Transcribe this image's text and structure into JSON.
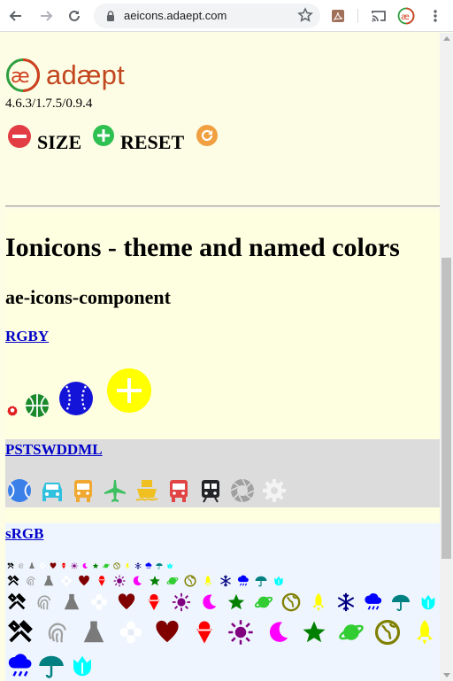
{
  "browser": {
    "url": "aeicons.adaept.com"
  },
  "header": {
    "logo_text": "adæpt",
    "version": "4.6.3/1.7.5/0.9.4",
    "size_label": "SIZE",
    "reset_label": "RESET"
  },
  "main": {
    "title": "Ionicons - theme and named colors",
    "subtitle": "ae-icons-component",
    "groups": [
      {
        "label": "RGBY"
      },
      {
        "label": "PSTSWDDML"
      },
      {
        "label": "sRGB"
      }
    ]
  },
  "colors": {
    "logo": "#c2461e",
    "remove": "#e23c44",
    "add": "#2ec050",
    "reset": "#f0a040",
    "link": "#0000c8",
    "yellow_band": "#fefee0",
    "grey_band": "#dcdcdc",
    "blue_band": "#eef5fe"
  }
}
